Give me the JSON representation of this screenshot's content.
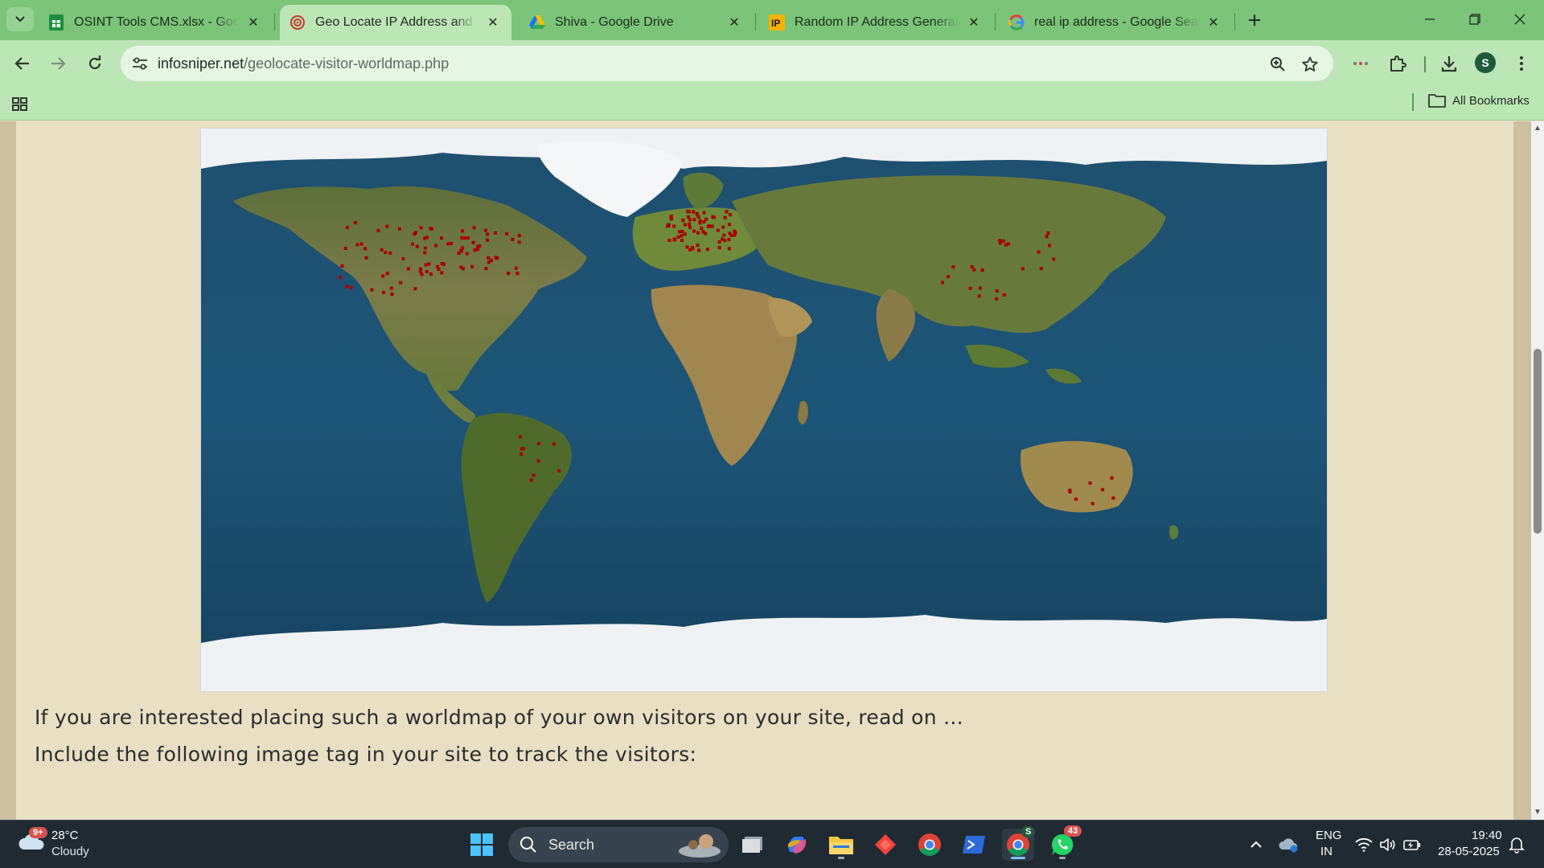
{
  "tabs": [
    {
      "title": "OSINT Tools CMS.xlsx - Google",
      "icon": "google-sheets-icon"
    },
    {
      "title": "Geo Locate IP Address and Wor",
      "icon": "infosniper-icon",
      "active": true
    },
    {
      "title": "Shiva - Google Drive",
      "icon": "google-drive-icon"
    },
    {
      "title": "Random IP Address Generator,",
      "icon": "ip-icon"
    },
    {
      "title": "real ip address - Google Search",
      "icon": "google-icon"
    }
  ],
  "tab_close_glyph": "✕",
  "address": {
    "domain": "infosniper.net",
    "path": "/geolocate-visitor-worldmap.php"
  },
  "profile_initial": "S",
  "bookmarks": {
    "all_label": "All Bookmarks"
  },
  "page": {
    "para1": "If you are interested placing such a worldmap of your own visitors on your site, read on ...",
    "para2": "Include the following image tag in your site to track the visitors:"
  },
  "taskbar": {
    "weather_temp": "28°C",
    "weather_desc": "Cloudy",
    "weather_badge": "9+",
    "search_label": "Search",
    "lang_top": "ENG",
    "lang_bottom": "IN",
    "time": "19:40",
    "date": "28-05-2025",
    "whatsapp_badge": "43",
    "chrome_badge": "S"
  },
  "colors": {
    "tabstrip": "#7cc47a",
    "toolbar": "#bde6b6",
    "page_bg": "#e9dfc2",
    "marker": "#a80000"
  }
}
